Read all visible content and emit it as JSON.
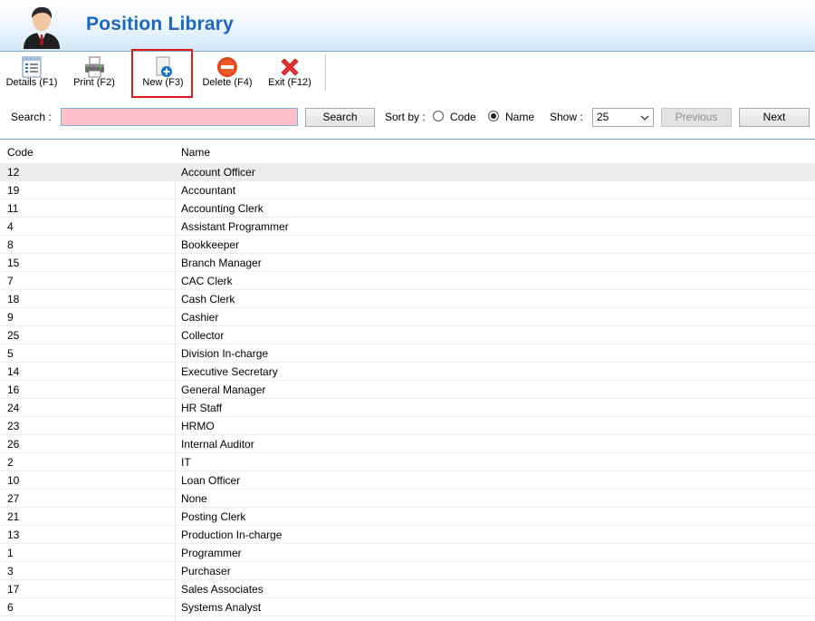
{
  "header": {
    "title": "Position Library",
    "avatar_icon": "user-avatar-icon"
  },
  "toolbar": {
    "buttons": [
      {
        "label": "Details (F1)",
        "icon": "details-icon"
      },
      {
        "label": "Print (F2)",
        "icon": "printer-icon"
      },
      {
        "label": "New (F3)",
        "icon": "new-document-icon"
      },
      {
        "label": "Delete (F4)",
        "icon": "delete-icon"
      },
      {
        "label": "Exit (F12)",
        "icon": "close-icon"
      }
    ]
  },
  "search": {
    "label": "Search :",
    "value": "",
    "button": "Search",
    "sort_label": "Sort by :",
    "sort_options": [
      "Code",
      "Name"
    ],
    "sort_selected": "Name",
    "show_label": "Show :",
    "show_value": "25",
    "previous": "Previous",
    "next": "Next"
  },
  "table": {
    "headers": [
      "Code",
      "Name"
    ],
    "rows": [
      {
        "code": "12",
        "name": "Account Officer"
      },
      {
        "code": "19",
        "name": "Accountant"
      },
      {
        "code": "11",
        "name": "Accounting Clerk"
      },
      {
        "code": "4",
        "name": "Assistant Programmer"
      },
      {
        "code": "8",
        "name": "Bookkeeper"
      },
      {
        "code": "15",
        "name": "Branch Manager"
      },
      {
        "code": "7",
        "name": "CAC Clerk"
      },
      {
        "code": "18",
        "name": "Cash Clerk"
      },
      {
        "code": "9",
        "name": "Cashier"
      },
      {
        "code": "25",
        "name": "Collector"
      },
      {
        "code": "5",
        "name": "Division In-charge"
      },
      {
        "code": "14",
        "name": "Executive Secretary"
      },
      {
        "code": "16",
        "name": "General Manager"
      },
      {
        "code": "24",
        "name": "HR Staff"
      },
      {
        "code": "23",
        "name": "HRMO"
      },
      {
        "code": "26",
        "name": "Internal Auditor"
      },
      {
        "code": "2",
        "name": "IT"
      },
      {
        "code": "10",
        "name": "Loan Officer"
      },
      {
        "code": "27",
        "name": "None"
      },
      {
        "code": "21",
        "name": "Posting Clerk"
      },
      {
        "code": "13",
        "name": "Production In-charge"
      },
      {
        "code": "1",
        "name": "Programmer"
      },
      {
        "code": "3",
        "name": "Purchaser"
      },
      {
        "code": "17",
        "name": "Sales Associates"
      },
      {
        "code": "6",
        "name": "Systems Analyst"
      }
    ]
  },
  "colors": {
    "title": "#1a66c0",
    "search_bg": "#ffc0cb",
    "highlight": "#e11a1a"
  }
}
